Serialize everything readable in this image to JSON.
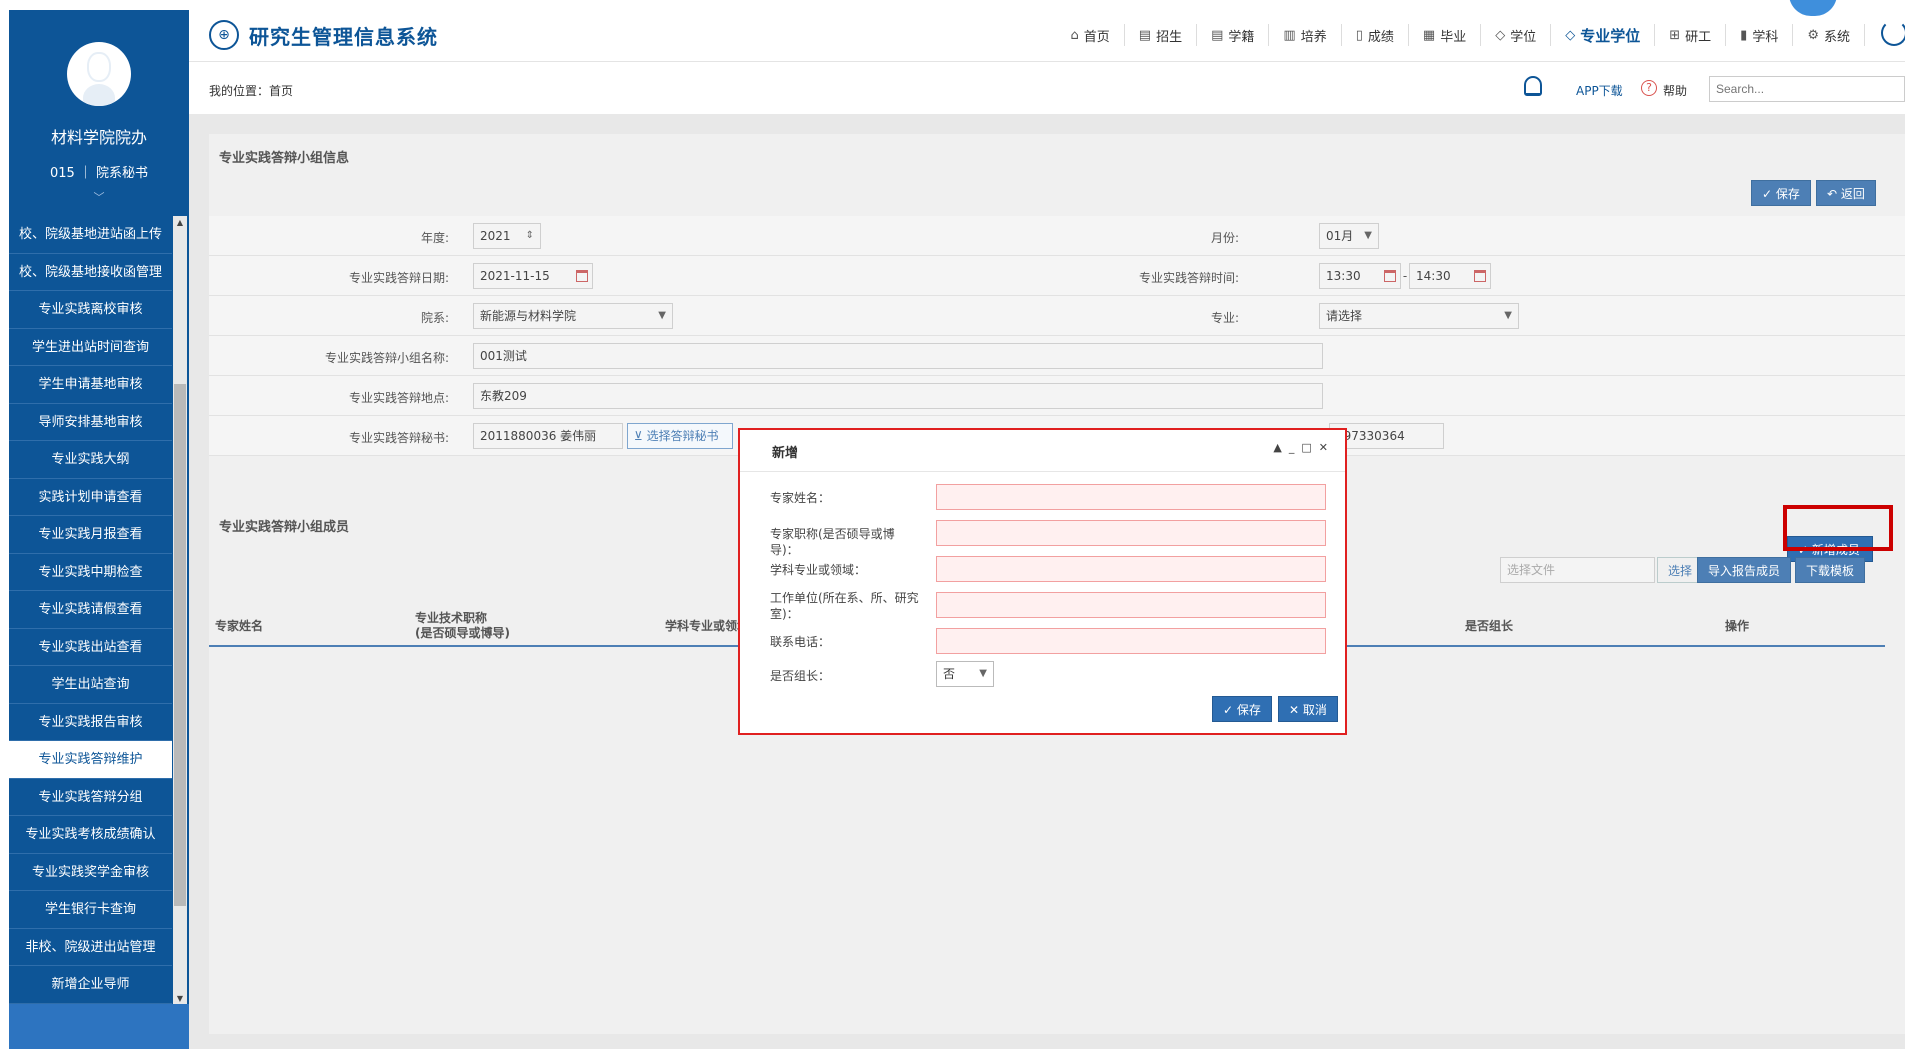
{
  "sidebar": {
    "dept_name": "材料学院院办",
    "user_line": "015 ｜ 院系秘书",
    "collapse_icon": "chevron-down-icon",
    "items": [
      {
        "label": "校、院级基地进站函上传"
      },
      {
        "label": "校、院级基地接收函管理"
      },
      {
        "label": "专业实践离校审核"
      },
      {
        "label": "学生进出站时间查询"
      },
      {
        "label": "学生申请基地审核"
      },
      {
        "label": "导师安排基地审核"
      },
      {
        "label": "专业实践大纲"
      },
      {
        "label": "实践计划申请查看"
      },
      {
        "label": "专业实践月报查看"
      },
      {
        "label": "专业实践中期检查"
      },
      {
        "label": "专业实践请假查看"
      },
      {
        "label": "专业实践出站查看"
      },
      {
        "label": "学生出站查询"
      },
      {
        "label": "专业实践报告审核"
      },
      {
        "label": "专业实践答辩维护",
        "active": true
      },
      {
        "label": "专业实践答辩分组"
      },
      {
        "label": "专业实践考核成绩确认"
      },
      {
        "label": "专业实践奖学金审核"
      },
      {
        "label": "学生银行卡查询"
      },
      {
        "label": "非校、院级进出站管理"
      },
      {
        "label": "新增企业导师"
      }
    ]
  },
  "header": {
    "title": "研究生管理信息系统",
    "nav": [
      {
        "label": "首页",
        "icon": "home-icon"
      },
      {
        "label": "招生",
        "icon": "id-card-icon"
      },
      {
        "label": "学籍",
        "icon": "id-card-icon"
      },
      {
        "label": "培养",
        "icon": "book-icon"
      },
      {
        "label": "成绩",
        "icon": "document-icon"
      },
      {
        "label": "毕业",
        "icon": "certificate-icon"
      },
      {
        "label": "学位",
        "icon": "graduation-cap-icon"
      },
      {
        "label": "专业学位",
        "icon": "graduation-cap-icon",
        "active": true
      },
      {
        "label": "研工",
        "icon": "grid-icon"
      },
      {
        "label": "学科",
        "icon": "building-icon"
      },
      {
        "label": "系统",
        "icon": "gear-icon"
      }
    ]
  },
  "subbar": {
    "breadcrumb": "我的位置：首页",
    "app_download": "APP下载",
    "help": "帮助",
    "search_placeholder": "Search..."
  },
  "form": {
    "section_title": "专业实践答辩小组信息",
    "save": "保存",
    "back": "返回",
    "year_label": "年度:",
    "year_value": "2021",
    "month_label": "月份:",
    "month_value": "01月",
    "date_label": "专业实践答辩日期:",
    "date_value": "2021-11-15",
    "time_label": "专业实践答辩时间:",
    "time_start": "13:30",
    "time_sep": "-",
    "time_end": "14:30",
    "dept_label": "院系:",
    "dept_value": "新能源与材料学院",
    "major_label": "专业:",
    "major_value": "请选择",
    "group_name_label": "专业实践答辩小组名称:",
    "group_name_value": "001测试",
    "place_label": "专业实践答辩地点:",
    "place_value": "东教209",
    "secretary_label": "专业实践答辩秘书:",
    "secretary_value": "2011880036 姜伟丽",
    "choose_secretary": "选择答辩秘书",
    "phone_value": "397330364"
  },
  "members": {
    "section_title": "专业实践答辩小组成员",
    "add_member": "新增成员",
    "file_placeholder": "选择文件",
    "choose": "选择",
    "import": "导入报告成员",
    "download_template": "下载模板",
    "columns": [
      "专家姓名",
      "专业技术职称\n(是否硕导或博导)",
      "学科专业或领域",
      "",
      "是否组长",
      "操作"
    ]
  },
  "modal": {
    "title": "新增",
    "fields": [
      {
        "label": "专家姓名："
      },
      {
        "label": "专家职称(是否硕导或博导)："
      },
      {
        "label": "学科专业或领域："
      },
      {
        "label": "工作单位(所在系、所、研究室)："
      },
      {
        "label": "联系电话："
      }
    ],
    "leader_label": "是否组长：",
    "leader_value": "否",
    "save": "保存",
    "cancel": "取消"
  },
  "colors": {
    "brand": "#0d5597",
    "button": "#4d7fb5",
    "highlight": "#e02020"
  }
}
